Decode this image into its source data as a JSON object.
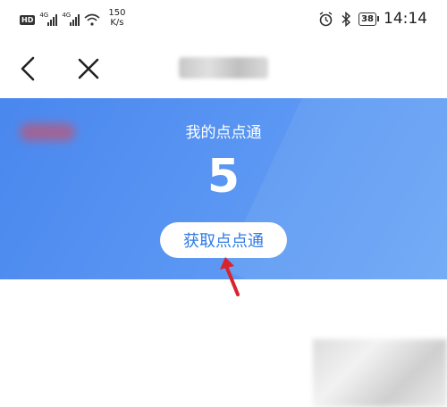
{
  "status_bar": {
    "hd_badge": "HD",
    "network_1": "4G",
    "network_2": "4G",
    "speed_value": "150",
    "speed_unit": "K/s",
    "battery": "38",
    "time": "14:14"
  },
  "nav": {
    "back_icon": "chevron-left-icon",
    "close_icon": "close-icon",
    "title": ""
  },
  "banner": {
    "title": "我的点点通",
    "value": "5",
    "button_label": "获取点点通",
    "colors": {
      "gradient_start": "#4a87ee",
      "gradient_end": "#6aa6f6",
      "button_text": "#2f7ae5"
    }
  },
  "annotation": {
    "arrow_icon": "red-arrow-icon",
    "color": "#d9232d"
  }
}
